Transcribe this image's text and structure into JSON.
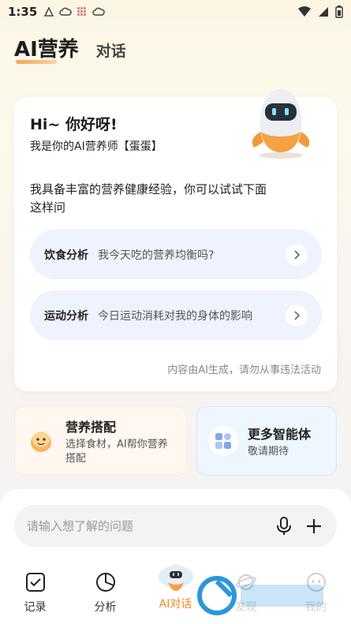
{
  "status_bar": {
    "time": "1:35"
  },
  "header": {
    "title": "AI营养",
    "tab_chat": "对话"
  },
  "card": {
    "greeting": "Hi~ 你好呀!",
    "intro_line": "我是你的AI营养师【蛋蛋】",
    "description": "我具备丰富的营养健康经验，你可以试试下面这样问",
    "suggestions": [
      {
        "label": "饮食分析",
        "question": "我今天吃的营养均衡吗?"
      },
      {
        "label": "运动分析",
        "question": "今日运动消耗对我的身体的影响"
      }
    ],
    "disclaimer": "内容由AI生成，请勿从事违法活动"
  },
  "shortcuts": [
    {
      "title": "营养搭配",
      "subtitle": "选择食材，AI帮你营养搭配"
    },
    {
      "title": "更多智能体",
      "subtitle": "敬请期待"
    }
  ],
  "input": {
    "placeholder": "请输入想了解的问题"
  },
  "nav": [
    {
      "label": "记录",
      "icon": "checkbox-icon"
    },
    {
      "label": "分析",
      "icon": "pie-chart-icon"
    },
    {
      "label": "AI对话",
      "icon": "egg-robot-icon"
    },
    {
      "label": "发现",
      "icon": "planet-icon"
    },
    {
      "label": "我的",
      "icon": "face-icon"
    }
  ],
  "colors": {
    "accent": "#f08a24",
    "pill_bg": "#eef3fd"
  }
}
